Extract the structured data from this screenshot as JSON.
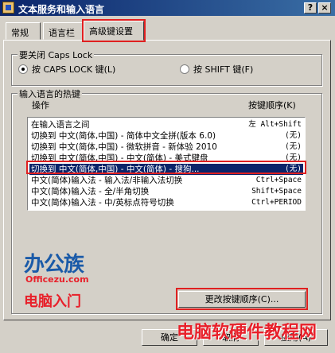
{
  "window": {
    "title": "文本服务和输入语言",
    "help": "?",
    "close": "×"
  },
  "tabs": [
    {
      "label": "常规"
    },
    {
      "label": "语言栏"
    },
    {
      "label": "高级键设置"
    }
  ],
  "caps": {
    "legend": "要关闭 Caps Lock",
    "opt1": "按 CAPS LOCK 键(L)",
    "opt2": "按 SHIFT 键(F)",
    "selected": "opt1"
  },
  "hotkeys": {
    "legend": "输入语言的热键",
    "col_action": "操作",
    "col_keys": "按键顺序(K)",
    "rows": [
      {
        "action": "在输入语言之间",
        "keys": "左 Alt+Shift"
      },
      {
        "action": "切换到 中文(简体,中国) - 简体中文全拼(版本 6.0)",
        "keys": "(无)"
      },
      {
        "action": "切换到 中文(简体,中国) - 微软拼音 - 新体验 2010",
        "keys": "(无)"
      },
      {
        "action": "切换到 中文(简体,中国) - 中文(简体) - 美式键盘",
        "keys": "(无)"
      },
      {
        "action": "切换到 中文(简体,中国) - 中文(简体) - 搜狗...",
        "keys": "(无)"
      },
      {
        "action": "中文(简体)输入法 - 输入法/非输入法切换",
        "keys": "Ctrl+Space"
      },
      {
        "action": "中文(简体)输入法 - 全/半角切换",
        "keys": "Shift+Space"
      },
      {
        "action": "中文(简体)输入法 - 中/英标点符号切换",
        "keys": "Ctrl+PERIOD"
      }
    ],
    "change_button": "更改按键顺序(C)..."
  },
  "watermark": {
    "logo1": "办公族",
    "logo1_url": "Officezu.com",
    "logo1_sub": "电脑入门",
    "logo2": "电脑软硬件教程网"
  },
  "footer": {
    "ok": "确定",
    "cancel": "取消",
    "apply": "应用(A)"
  },
  "colors": {
    "selection": "#0a246a",
    "highlight_box": "#e02020",
    "watermark_red": "#e8202a",
    "watermark_blue": "#1a5aa8"
  }
}
